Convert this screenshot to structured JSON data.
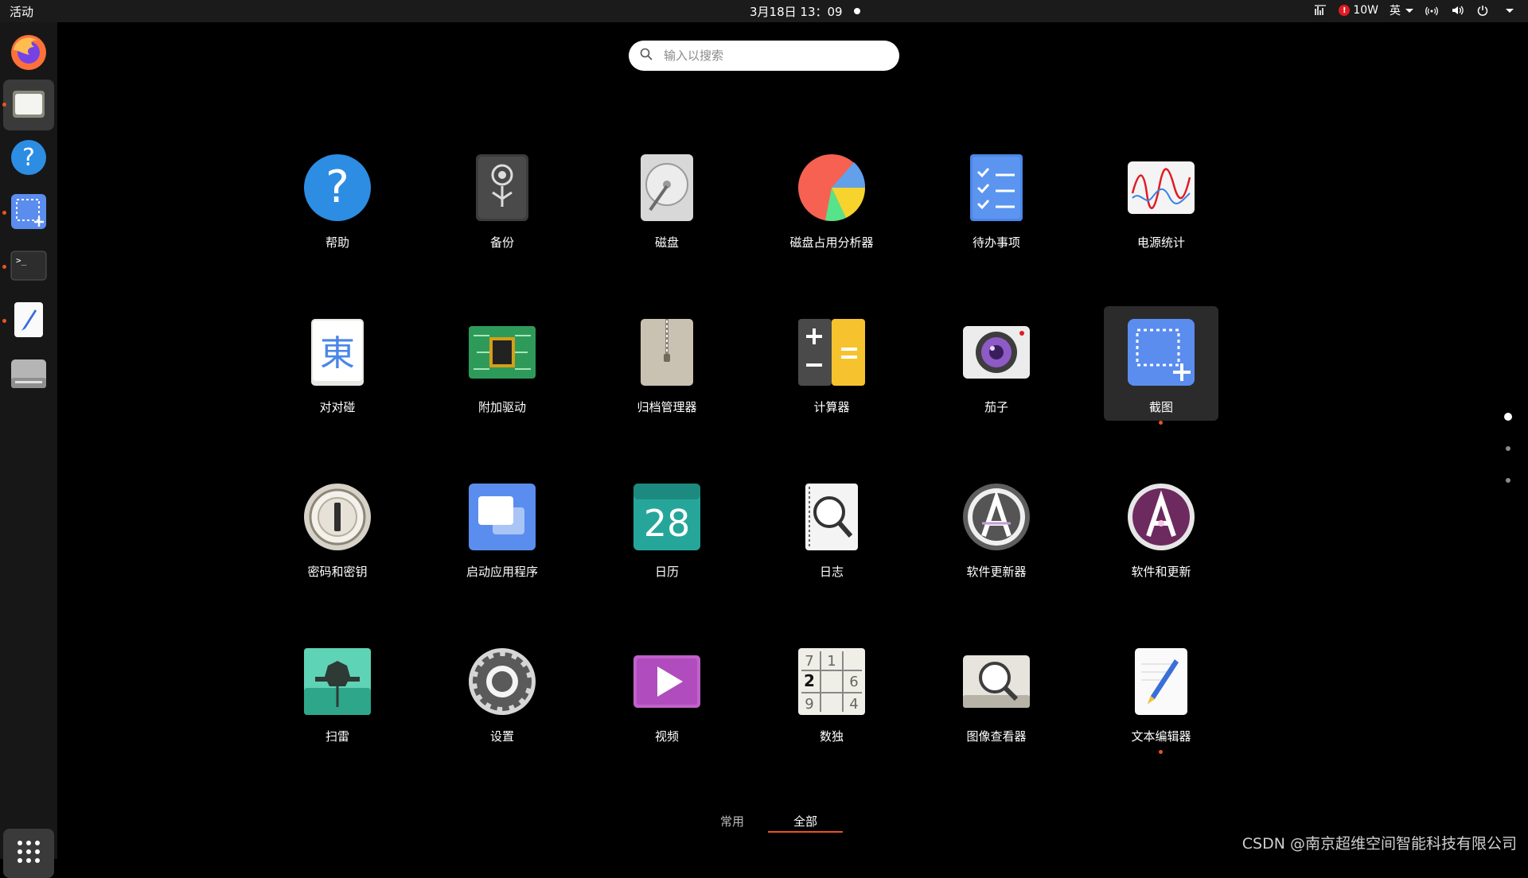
{
  "topbar": {
    "activities": "活动",
    "clock": "3月18日  13：09",
    "alert_power": "10W",
    "input_method": "英"
  },
  "dock": {
    "items": [
      {
        "name": "firefox-icon",
        "running": false,
        "active": false
      },
      {
        "name": "files-icon",
        "running": true,
        "active": true
      },
      {
        "name": "help-icon",
        "running": false,
        "active": false
      },
      {
        "name": "screenshot-icon",
        "running": true,
        "active": false
      },
      {
        "name": "terminal-icon",
        "running": true,
        "active": false
      },
      {
        "name": "text-editor-icon",
        "running": true,
        "active": false
      },
      {
        "name": "drive-icon",
        "running": false,
        "active": false
      }
    ],
    "show_apps": "show-applications-icon"
  },
  "search": {
    "placeholder": "输入以搜索"
  },
  "apps": [
    {
      "label": "帮助",
      "icon": "help-icon"
    },
    {
      "label": "备份",
      "icon": "backup-icon"
    },
    {
      "label": "磁盘",
      "icon": "disks-icon"
    },
    {
      "label": "磁盘占用分析器",
      "icon": "disk-usage-icon"
    },
    {
      "label": "待办事项",
      "icon": "todo-icon"
    },
    {
      "label": "电源统计",
      "icon": "power-stats-icon"
    },
    {
      "label": "对对碰",
      "icon": "mahjongg-icon"
    },
    {
      "label": "附加驱动",
      "icon": "drivers-icon"
    },
    {
      "label": "归档管理器",
      "icon": "archive-icon"
    },
    {
      "label": "计算器",
      "icon": "calculator-icon"
    },
    {
      "label": "茄子",
      "icon": "cheese-icon"
    },
    {
      "label": "截图",
      "icon": "screenshot-icon",
      "selected": true,
      "running": true
    },
    {
      "label": "密码和密钥",
      "icon": "passwords-icon"
    },
    {
      "label": "启动应用程序",
      "icon": "startup-apps-icon"
    },
    {
      "label": "日历",
      "icon": "calendar-icon",
      "icon_text": "28"
    },
    {
      "label": "日志",
      "icon": "logs-icon"
    },
    {
      "label": "软件更新器",
      "icon": "software-updater-icon"
    },
    {
      "label": "软件和更新",
      "icon": "software-sources-icon"
    },
    {
      "label": "扫雷",
      "icon": "mines-icon"
    },
    {
      "label": "设置",
      "icon": "settings-icon"
    },
    {
      "label": "视频",
      "icon": "videos-icon"
    },
    {
      "label": "数独",
      "icon": "sudoku-icon",
      "icon_digits": [
        "7",
        "1",
        "2",
        "6",
        "9",
        "4"
      ]
    },
    {
      "label": "图像查看器",
      "icon": "image-viewer-icon"
    },
    {
      "label": "文本编辑器",
      "icon": "text-editor-icon",
      "running": true
    }
  ],
  "pages": {
    "count": 3,
    "current": 1
  },
  "tabs": {
    "common": "常用",
    "all": "全部"
  },
  "watermark": "CSDN @南京超维空间智能科技有限公司",
  "colors": {
    "accent": "#e95420",
    "topbar": "#1b1b1b",
    "dock": "#171717"
  }
}
